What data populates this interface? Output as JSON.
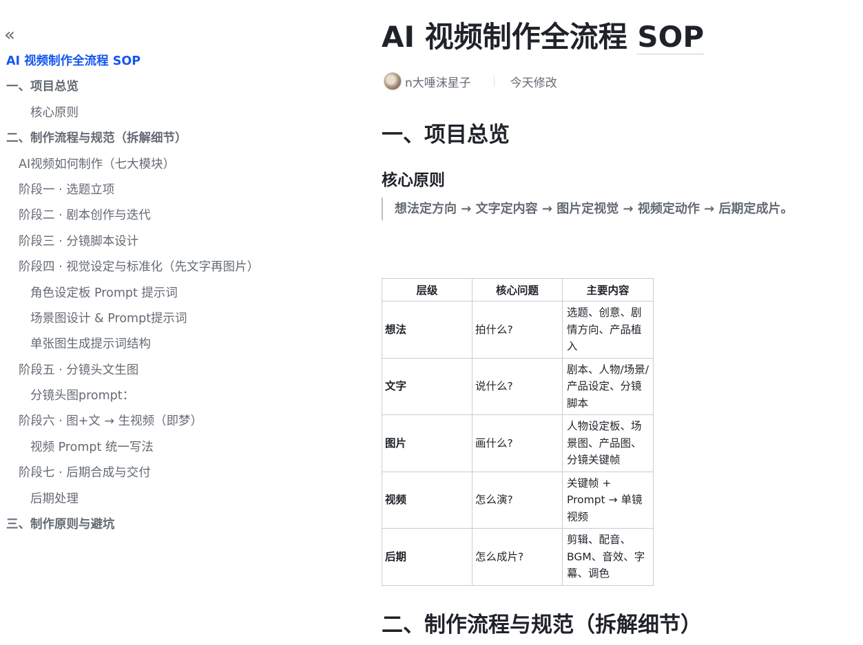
{
  "sidebar": {
    "collapse_icon": "«",
    "toc": [
      {
        "label": "AI 视频制作全流程 SOP",
        "level": 0,
        "active": true
      },
      {
        "label": "一、项目总览",
        "level": 1
      },
      {
        "label": "核心原则",
        "level": 3
      },
      {
        "label": "二、制作流程与规范（拆解细节）",
        "level": 1
      },
      {
        "label": "AI视频如何制作（七大模块）",
        "level": 2
      },
      {
        "label": "阶段一 · 选题立项",
        "level": 2
      },
      {
        "label": "阶段二 · 剧本创作与迭代",
        "level": 2
      },
      {
        "label": "阶段三 · 分镜脚本设计",
        "level": 2
      },
      {
        "label": "阶段四 · 视觉设定与标准化（先文字再图片）",
        "level": 2
      },
      {
        "label": "角色设定板 Prompt 提示词",
        "level": 3
      },
      {
        "label": "场景图设计 & Prompt提示词",
        "level": 3
      },
      {
        "label": "单张图生成提示词结构",
        "level": 3
      },
      {
        "label": "阶段五 · 分镜头文生图",
        "level": 2
      },
      {
        "label": "分镜头图prompt：",
        "level": 3
      },
      {
        "label": "阶段六 · 图+文 → 生视频（即梦）",
        "level": 2
      },
      {
        "label": "视频 Prompt 统一写法",
        "level": 3
      },
      {
        "label": "阶段七 · 后期合成与交付",
        "level": 2
      },
      {
        "label": "后期处理",
        "level": 3
      },
      {
        "label": "三、制作原则与避坑",
        "level": 1
      }
    ]
  },
  "doc": {
    "title_main": "AI 视频制作全流程 ",
    "title_tail": "SOP",
    "author": "n大唾沫星子",
    "modified": "今天修改",
    "h1_overview": "一、项目总览",
    "h2_core": "核心原则",
    "quote": "想法定方向 → 文字定内容 → 图片定视觉 → 视频定动作 → 后期定成片。",
    "table": {
      "headers": [
        "层级",
        "核心问题",
        "主要内容"
      ],
      "rows": [
        [
          "想法",
          "拍什么?",
          "选题、创意、剧情方向、产品植入"
        ],
        [
          "文字",
          "说什么?",
          "剧本、人物/场景/产品设定、分镜脚本"
        ],
        [
          "图片",
          "画什么?",
          "人物设定板、场景图、产品图、分镜关键帧"
        ],
        [
          "视频",
          "怎么演?",
          "关键帧 + Prompt → 单镜视频"
        ],
        [
          "后期",
          "怎么成片?",
          "剪辑、配音、BGM、音效、字幕、调色"
        ]
      ]
    },
    "h1_process": "二、制作流程与规范（拆解细节）"
  },
  "colors": {
    "accent": "#1456f0",
    "text": "#1f2329",
    "muted": "#646a73",
    "border": "#c9ccd1"
  }
}
